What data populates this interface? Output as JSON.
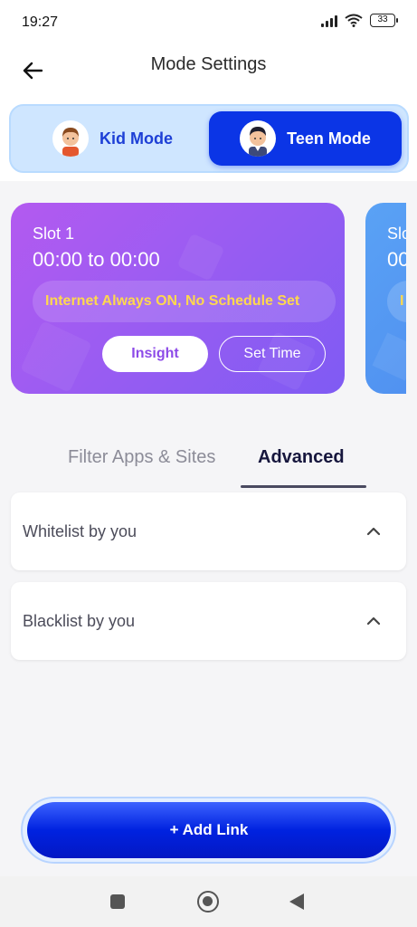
{
  "status_bar": {
    "time": "19:27",
    "battery": "33"
  },
  "header": {
    "title": "Mode Settings"
  },
  "modes": {
    "kid_label": "Kid Mode",
    "teen_label": "Teen Mode",
    "selected": "Teen Mode"
  },
  "slots": [
    {
      "name": "Slot 1",
      "time": "00:00 to 00:00",
      "status": "Internet Always ON, No Schedule Set",
      "insight_label": "Insight",
      "set_time_label": "Set Time"
    },
    {
      "name": "Slo",
      "time": "00",
      "status": "I"
    }
  ],
  "tabs": {
    "filter": "Filter Apps & Sites",
    "advanced": "Advanced",
    "active": "Advanced"
  },
  "lists": {
    "whitelist": "Whitelist by you",
    "blacklist": "Blacklist by you"
  },
  "actions": {
    "add_link": "+ Add Link"
  },
  "colors": {
    "accent_blue": "#0b35e6",
    "slot_purple": "#9b5cf2",
    "slot_blue": "#4f8ff0",
    "status_yellow": "#ffd84d"
  },
  "icons": [
    "back-arrow-icon",
    "signal-icon",
    "wifi-icon",
    "battery-icon",
    "chevron-up-icon",
    "nav-recents-icon",
    "nav-home-icon",
    "nav-back-icon"
  ]
}
